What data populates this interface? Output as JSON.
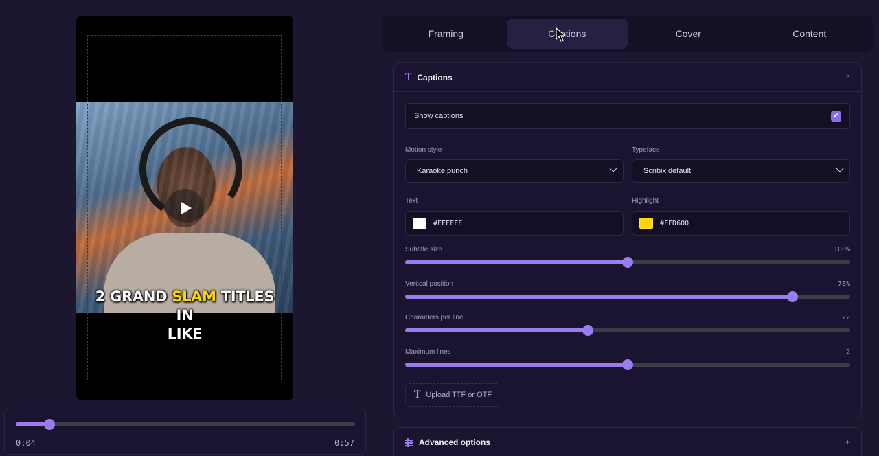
{
  "preview": {
    "caption_lines": [
      {
        "before": "2 GRAND ",
        "highlight": "SLAM",
        "after": " TITLES"
      },
      {
        "before": "IN",
        "highlight": "",
        "after": ""
      },
      {
        "before": "LIKE",
        "highlight": "",
        "after": ""
      }
    ]
  },
  "player": {
    "current_time": "0:04",
    "duration": "0:57",
    "progress": 0.1
  },
  "tabs": [
    {
      "label": "Framing",
      "active": false
    },
    {
      "label": "Captions",
      "active": true
    },
    {
      "label": "Cover",
      "active": false
    },
    {
      "label": "Content",
      "active": false
    }
  ],
  "captions_panel": {
    "title": "Captions",
    "close_label": "×",
    "show_captions_label": "Show captions",
    "show_captions_checked": true,
    "motion_style": {
      "label": "Motion style",
      "value": "Karaoke punch"
    },
    "typeface": {
      "label": "Typeface",
      "value": "Scribix default"
    },
    "text_color": {
      "label": "Text",
      "hex": "#FFFFFF"
    },
    "highlight_color": {
      "label": "Highlight",
      "hex": "#FFD600"
    },
    "sliders": [
      {
        "id": "subtitle-size",
        "label": "Subtitle size",
        "value_text": "100%",
        "fraction": 0.5
      },
      {
        "id": "vertical-position",
        "label": "Vertical position",
        "value_text": "78%",
        "fraction": 0.87
      },
      {
        "id": "characters-per-line",
        "label": "Characters per line",
        "value_text": "22",
        "fraction": 0.41
      },
      {
        "id": "maximum-lines",
        "label": "Maximum lines",
        "value_text": "2",
        "fraction": 0.5
      }
    ],
    "upload_label": "Upload TTF or OTF"
  },
  "advanced": {
    "title": "Advanced options",
    "expand_label": "+"
  },
  "colors": {
    "accent": "#9b7cf0",
    "highlight": "#FFD600",
    "background": "#1c1630"
  }
}
